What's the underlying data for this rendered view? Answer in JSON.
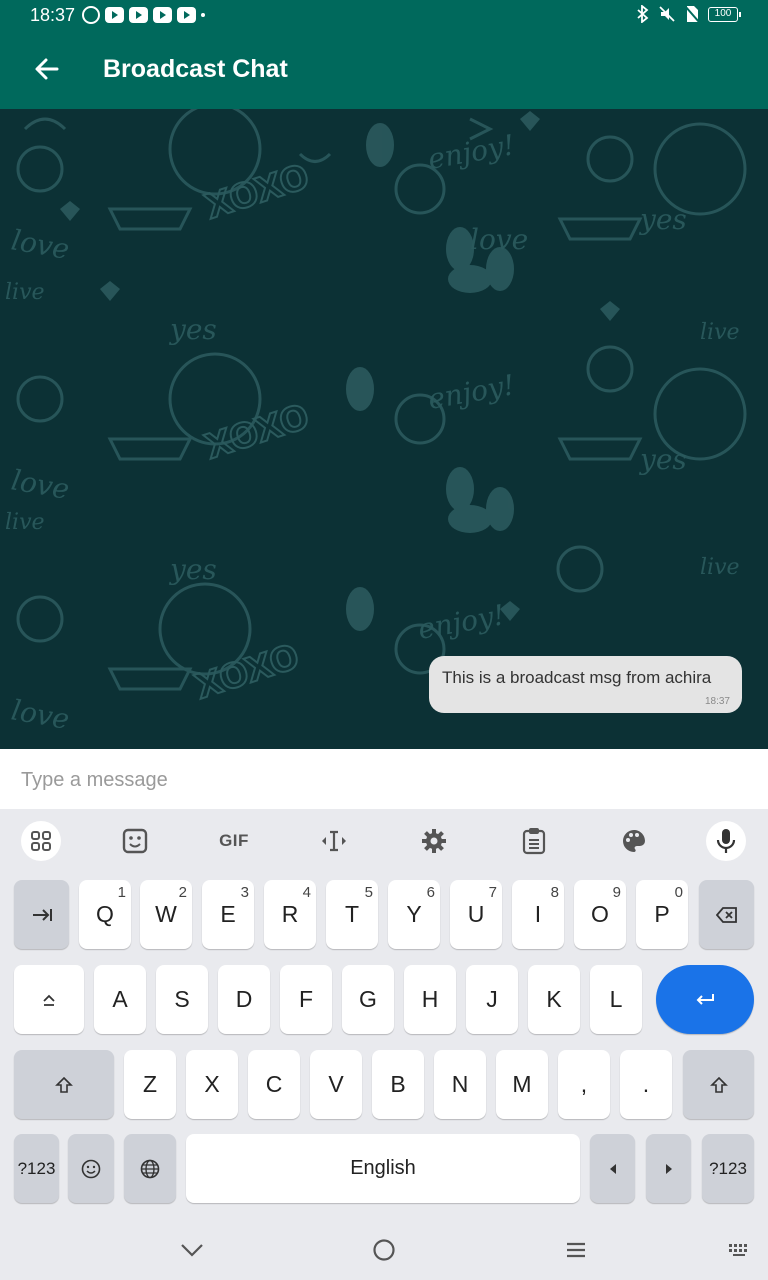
{
  "status_bar": {
    "time": "18:37",
    "battery": "100",
    "notification_icons": [
      "whatsapp-icon",
      "youtube-icon",
      "youtube-icon",
      "youtube-icon",
      "youtube-icon"
    ],
    "system_icons": [
      "bluetooth-icon",
      "mute-icon",
      "no-sim-icon",
      "battery-icon"
    ]
  },
  "app_bar": {
    "title": "Broadcast Chat",
    "back_icon": "arrow-left-icon",
    "color": "#00695c"
  },
  "chat": {
    "background": "#0c3135",
    "messages": [
      {
        "text": "This is a broadcast msg from achira",
        "time": "18:37",
        "outgoing": true
      }
    ]
  },
  "composer": {
    "placeholder": "Type a message"
  },
  "keyboard": {
    "toolbar": [
      "apps-grid-icon",
      "sticker-icon",
      "GIF",
      "text-cursor-icon",
      "settings-gear-icon",
      "clipboard-icon",
      "palette-icon",
      "microphone-icon"
    ],
    "gif_label": "GIF",
    "row1": [
      {
        "label": "Q",
        "hint": "1"
      },
      {
        "label": "W",
        "hint": "2"
      },
      {
        "label": "E",
        "hint": "3"
      },
      {
        "label": "R",
        "hint": "4"
      },
      {
        "label": "T",
        "hint": "5"
      },
      {
        "label": "Y",
        "hint": "6"
      },
      {
        "label": "U",
        "hint": "7"
      },
      {
        "label": "I",
        "hint": "8"
      },
      {
        "label": "O",
        "hint": "9"
      },
      {
        "label": "P",
        "hint": "0"
      }
    ],
    "row2": [
      "A",
      "S",
      "D",
      "F",
      "G",
      "H",
      "J",
      "K",
      "L"
    ],
    "row3": [
      "Z",
      "X",
      "C",
      "V",
      "B",
      "N",
      "M",
      ",",
      "."
    ],
    "symbols_label": "?123",
    "space_label": "English",
    "enter_color": "#1a73e8"
  },
  "nav_bar": [
    "chevron-down-icon",
    "home-circle-icon",
    "menu-icon",
    "keyboard-icon"
  ]
}
